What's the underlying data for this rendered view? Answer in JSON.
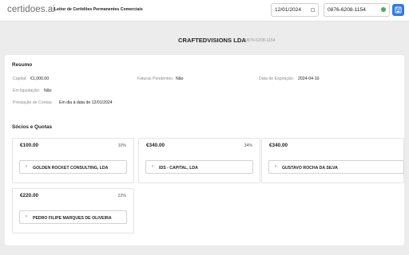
{
  "app": {
    "logo_main": "certidoes",
    "logo_dot": ".",
    "logo_ai": "ai",
    "title": "Leitor de Certidões Permanentes Comerciais"
  },
  "inputs": {
    "date_value": "12/01/2024",
    "code_value": "0876-6208-1154",
    "status_color": "#4caf50"
  },
  "save_button": {
    "icon": "save-icon",
    "color": "#2f7ae5"
  },
  "company": {
    "name": "CRAFTEDVISIONS LDA",
    "code": "0876-6208-1154"
  },
  "resumo": {
    "title": "Resumo",
    "capital_label": "Capital:",
    "capital_value": "€1,000.00",
    "faturas_label": "Faturas Pendentes:",
    "faturas_value": "Não",
    "expiracao_label": "Data de Expiração:",
    "expiracao_value": "2024-04-10",
    "liquidacao_label": "Em liquidação:",
    "liquidacao_value": "Não",
    "prestacao_label": "Prestação de Contas:",
    "prestacao_value": "Em dia à data de 12/01/2024"
  },
  "socios": {
    "title": "Sócios e Quotas",
    "items": [
      {
        "amount": "€100.00",
        "percent": "10%",
        "name": "GOLDEN ROCKET CONSULTING, LDA"
      },
      {
        "amount": "€340.00",
        "percent": "34%",
        "name": "IDS - CAPITAL, LDA"
      },
      {
        "amount": "€340.00",
        "percent": "",
        "name": "GUSTAVO ROCHA DA SILVA"
      },
      {
        "amount": "€220.00",
        "percent": "22%",
        "name": "PEDRO FILIPE MARQUES DE OLIVEIRA"
      }
    ]
  }
}
